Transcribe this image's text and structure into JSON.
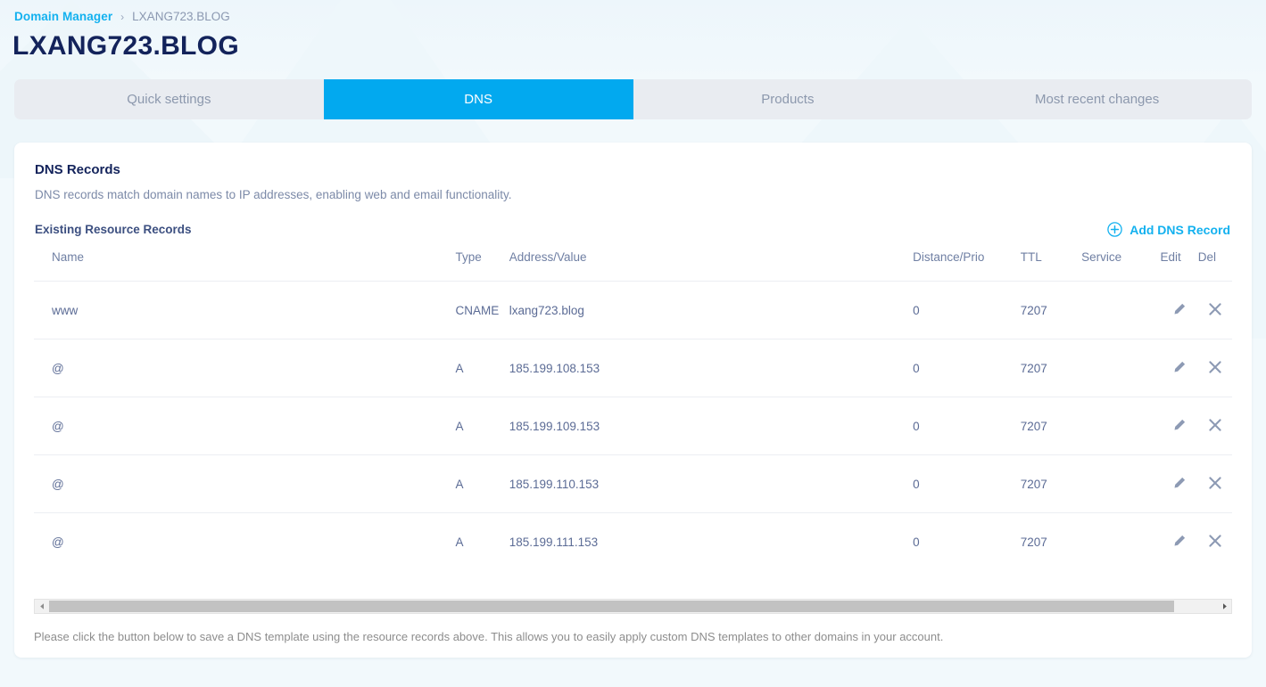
{
  "breadcrumb": {
    "root_label": "Domain Manager",
    "separator": "›",
    "current_label": "LXANG723.BLOG"
  },
  "page_title": "LXANG723.BLOG",
  "tabs": [
    {
      "label": "Quick settings",
      "active": false
    },
    {
      "label": "DNS",
      "active": true
    },
    {
      "label": "Products",
      "active": false
    },
    {
      "label": "Most recent changes",
      "active": false
    }
  ],
  "card": {
    "title": "DNS Records",
    "description": "DNS records match domain names to IP addresses, enabling web and email functionality.",
    "section_title": "Existing Resource Records",
    "add_record_label": "Add DNS Record",
    "add_record_icon": "plus-circle-icon"
  },
  "table": {
    "headers": {
      "name": "Name",
      "type": "Type",
      "value": "Address/Value",
      "distance": "Distance/Prio",
      "ttl": "TTL",
      "service": "Service",
      "edit": "Edit",
      "del": "Del"
    },
    "rows": [
      {
        "name": "www",
        "type": "CNAME",
        "value": "lxang723.blog",
        "distance": "0",
        "ttl": "7207",
        "service": ""
      },
      {
        "name": "@",
        "type": "A",
        "value": "185.199.108.153",
        "distance": "0",
        "ttl": "7207",
        "service": ""
      },
      {
        "name": "@",
        "type": "A",
        "value": "185.199.109.153",
        "distance": "0",
        "ttl": "7207",
        "service": ""
      },
      {
        "name": "@",
        "type": "A",
        "value": "185.199.110.153",
        "distance": "0",
        "ttl": "7207",
        "service": ""
      },
      {
        "name": "@",
        "type": "A",
        "value": "185.199.111.153",
        "distance": "0",
        "ttl": "7207",
        "service": ""
      }
    ],
    "row_icons": {
      "edit": "pencil-icon",
      "delete": "close-x-icon"
    }
  },
  "scrollbar": {
    "left_arrow_icon": "triangle-left-icon",
    "right_arrow_icon": "triangle-right-icon"
  },
  "footer_note": "Please click the button below to save a DNS template using the resource records above. This allows you to easily apply custom DNS templates to other domains in your account.",
  "colors": {
    "accent": "#02a9ef",
    "link": "#13b1ef",
    "title": "#13235b",
    "muted_text": "#7c8aa8",
    "table_text": "#5b6b95",
    "tab_inactive_bg": "#e9ecf1",
    "page_bg": "#f2f9fc"
  }
}
